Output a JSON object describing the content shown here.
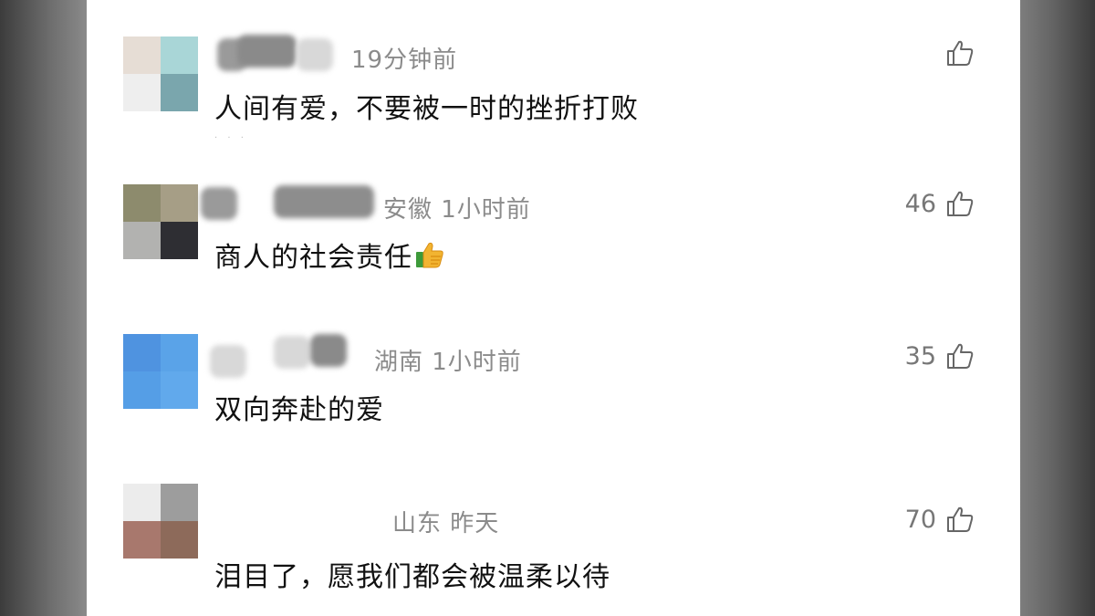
{
  "comments": [
    {
      "meta": "19分钟前",
      "text": "人间有爱，不要被一时的挫折打败",
      "likes": "",
      "avatar_colors": [
        "#e6ddd5",
        "#a9d6d7",
        "#eeeeee",
        "#7aa6ad"
      ]
    },
    {
      "meta": "安徽  1小时前",
      "text": "商人的社会责任",
      "likes": "46",
      "avatar_colors": [
        "#8d8b6d",
        "#a69e86",
        "#b2b2b0",
        "#2e2e33"
      ]
    },
    {
      "meta": "湖南  1小时前",
      "text": "双向奔赴的爱",
      "likes": "35",
      "avatar_colors": [
        "#4f93e0",
        "#5aa3e8",
        "#559ee6",
        "#61a9ec"
      ]
    },
    {
      "meta": "山东  昨天",
      "text": "泪目了，愿我们都会被温柔以待",
      "likes": "70",
      "avatar_colors": [
        "#ececec",
        "#9d9d9d",
        "#a8786d",
        "#8d6a5a"
      ]
    }
  ],
  "icons": {
    "like": "thumbs-up-icon",
    "emoji": "thumbs-up-emoji"
  }
}
